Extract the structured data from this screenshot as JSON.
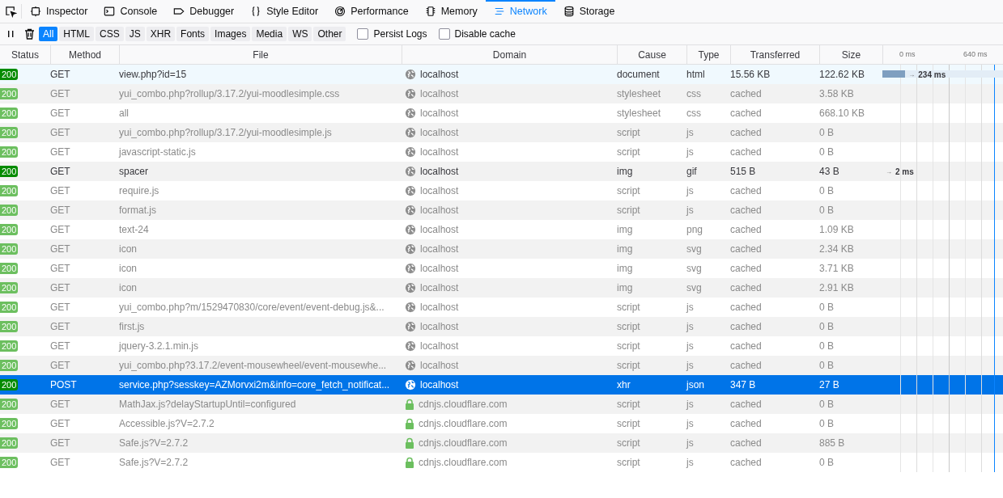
{
  "tabs": [
    {
      "label": "Inspector",
      "selected": false
    },
    {
      "label": "Console",
      "selected": false
    },
    {
      "label": "Debugger",
      "selected": false
    },
    {
      "label": "Style Editor",
      "selected": false
    },
    {
      "label": "Performance",
      "selected": false
    },
    {
      "label": "Memory",
      "selected": false
    },
    {
      "label": "Network",
      "selected": true
    },
    {
      "label": "Storage",
      "selected": false
    }
  ],
  "filters": [
    {
      "label": "All",
      "selected": true
    },
    {
      "label": "HTML",
      "selected": false
    },
    {
      "label": "CSS",
      "selected": false
    },
    {
      "label": "JS",
      "selected": false
    },
    {
      "label": "XHR",
      "selected": false
    },
    {
      "label": "Fonts",
      "selected": false
    },
    {
      "label": "Images",
      "selected": false
    },
    {
      "label": "Media",
      "selected": false
    },
    {
      "label": "WS",
      "selected": false
    },
    {
      "label": "Other",
      "selected": false
    }
  ],
  "options": [
    {
      "label": "Persist Logs",
      "checked": false
    },
    {
      "label": "Disable cache",
      "checked": false
    }
  ],
  "columns": [
    "Status",
    "Method",
    "File",
    "Domain",
    "Cause",
    "Type",
    "Transferred",
    "Size"
  ],
  "waterfall_ticks": [
    "0 ms",
    "640 ms"
  ],
  "rows": [
    {
      "status": "200",
      "method": "GET",
      "file": "view.php?id=15",
      "domain": "localhost",
      "secure": false,
      "cause": "document",
      "type": "html",
      "transferred": "15.56 KB",
      "size": "122.62 KB",
      "cached": false,
      "selected": false,
      "hovered": true,
      "timing": {
        "arrow": "→",
        "label": "234 ms",
        "level": 0.19
      }
    },
    {
      "status": "200",
      "method": "GET",
      "file": "yui_combo.php?rollup/3.17.2/yui-moodlesimple.css",
      "domain": "localhost",
      "secure": false,
      "cause": "stylesheet",
      "type": "css",
      "transferred": "cached",
      "size": "3.58 KB",
      "cached": true,
      "selected": false,
      "hovered": false
    },
    {
      "status": "200",
      "method": "GET",
      "file": "all",
      "domain": "localhost",
      "secure": false,
      "cause": "stylesheet",
      "type": "css",
      "transferred": "cached",
      "size": "668.10 KB",
      "cached": true,
      "selected": false,
      "hovered": false
    },
    {
      "status": "200",
      "method": "GET",
      "file": "yui_combo.php?rollup/3.17.2/yui-moodlesimple.js",
      "domain": "localhost",
      "secure": false,
      "cause": "script",
      "type": "js",
      "transferred": "cached",
      "size": "0 B",
      "cached": true,
      "selected": false,
      "hovered": false
    },
    {
      "status": "200",
      "method": "GET",
      "file": "javascript-static.js",
      "domain": "localhost",
      "secure": false,
      "cause": "script",
      "type": "js",
      "transferred": "cached",
      "size": "0 B",
      "cached": true,
      "selected": false,
      "hovered": false
    },
    {
      "status": "200",
      "method": "GET",
      "file": "spacer",
      "domain": "localhost",
      "secure": false,
      "cause": "img",
      "type": "gif",
      "transferred": "515 B",
      "size": "43 B",
      "cached": false,
      "selected": false,
      "hovered": false,
      "timing": {
        "arrow": "→",
        "label": "2 ms"
      }
    },
    {
      "status": "200",
      "method": "GET",
      "file": "require.js",
      "domain": "localhost",
      "secure": false,
      "cause": "script",
      "type": "js",
      "transferred": "cached",
      "size": "0 B",
      "cached": true,
      "selected": false,
      "hovered": false
    },
    {
      "status": "200",
      "method": "GET",
      "file": "format.js",
      "domain": "localhost",
      "secure": false,
      "cause": "script",
      "type": "js",
      "transferred": "cached",
      "size": "0 B",
      "cached": true,
      "selected": false,
      "hovered": false
    },
    {
      "status": "200",
      "method": "GET",
      "file": "text-24",
      "domain": "localhost",
      "secure": false,
      "cause": "img",
      "type": "png",
      "transferred": "cached",
      "size": "1.09 KB",
      "cached": true,
      "selected": false,
      "hovered": false
    },
    {
      "status": "200",
      "method": "GET",
      "file": "icon",
      "domain": "localhost",
      "secure": false,
      "cause": "img",
      "type": "svg",
      "transferred": "cached",
      "size": "2.34 KB",
      "cached": true,
      "selected": false,
      "hovered": false
    },
    {
      "status": "200",
      "method": "GET",
      "file": "icon",
      "domain": "localhost",
      "secure": false,
      "cause": "img",
      "type": "svg",
      "transferred": "cached",
      "size": "3.71 KB",
      "cached": true,
      "selected": false,
      "hovered": false
    },
    {
      "status": "200",
      "method": "GET",
      "file": "icon",
      "domain": "localhost",
      "secure": false,
      "cause": "img",
      "type": "svg",
      "transferred": "cached",
      "size": "2.91 KB",
      "cached": true,
      "selected": false,
      "hovered": false
    },
    {
      "status": "200",
      "method": "GET",
      "file": "yui_combo.php?m/1529470830/core/event/event-debug.js&...",
      "domain": "localhost",
      "secure": false,
      "cause": "script",
      "type": "js",
      "transferred": "cached",
      "size": "0 B",
      "cached": true,
      "selected": false,
      "hovered": false
    },
    {
      "status": "200",
      "method": "GET",
      "file": "first.js",
      "domain": "localhost",
      "secure": false,
      "cause": "script",
      "type": "js",
      "transferred": "cached",
      "size": "0 B",
      "cached": true,
      "selected": false,
      "hovered": false
    },
    {
      "status": "200",
      "method": "GET",
      "file": "jquery-3.2.1.min.js",
      "domain": "localhost",
      "secure": false,
      "cause": "script",
      "type": "js",
      "transferred": "cached",
      "size": "0 B",
      "cached": true,
      "selected": false,
      "hovered": false
    },
    {
      "status": "200",
      "method": "GET",
      "file": "yui_combo.php?3.17.2/event-mousewheel/event-mousewhe...",
      "domain": "localhost",
      "secure": false,
      "cause": "script",
      "type": "js",
      "transferred": "cached",
      "size": "0 B",
      "cached": true,
      "selected": false,
      "hovered": false
    },
    {
      "status": "200",
      "method": "POST",
      "file": "service.php?sesskey=AZMorvxi2m&info=core_fetch_notificat...",
      "domain": "localhost",
      "secure": false,
      "cause": "xhr",
      "type": "json",
      "transferred": "347 B",
      "size": "27 B",
      "cached": false,
      "selected": true,
      "hovered": false
    },
    {
      "status": "200",
      "method": "GET",
      "file": "MathJax.js?delayStartupUntil=configured",
      "domain": "cdnjs.cloudflare.com",
      "secure": true,
      "cause": "script",
      "type": "js",
      "transferred": "cached",
      "size": "0 B",
      "cached": true,
      "selected": false,
      "hovered": false
    },
    {
      "status": "200",
      "method": "GET",
      "file": "Accessible.js?V=2.7.2",
      "domain": "cdnjs.cloudflare.com",
      "secure": true,
      "cause": "script",
      "type": "js",
      "transferred": "cached",
      "size": "0 B",
      "cached": true,
      "selected": false,
      "hovered": false
    },
    {
      "status": "200",
      "method": "GET",
      "file": "Safe.js?V=2.7.2",
      "domain": "cdnjs.cloudflare.com",
      "secure": true,
      "cause": "script",
      "type": "js",
      "transferred": "cached",
      "size": "885 B",
      "cached": true,
      "selected": false,
      "hovered": false
    },
    {
      "status": "200",
      "method": "GET",
      "file": "Safe.js?V=2.7.2",
      "domain": "cdnjs.cloudflare.com",
      "secure": true,
      "cause": "script",
      "type": "js",
      "transferred": "cached",
      "size": "0 B",
      "cached": true,
      "selected": false,
      "hovered": false
    }
  ]
}
